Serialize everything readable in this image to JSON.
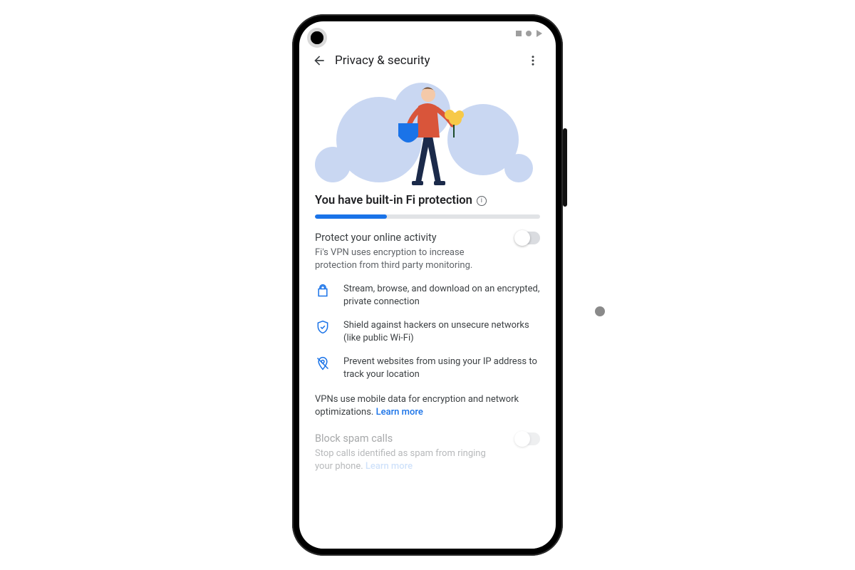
{
  "header": {
    "title": "Privacy & security"
  },
  "headline": "You have built-in Fi protection",
  "progress": {
    "percent": 32
  },
  "vpn": {
    "title": "Protect your online activity",
    "desc": "Fi's VPN uses encryption to increase protection from third party monitoring.",
    "toggle_on": false
  },
  "features": [
    {
      "icon": "lock-icon",
      "text": "Stream, browse, and download on an encrypted, private connection"
    },
    {
      "icon": "shield-check-icon",
      "text": "Shield against hackers on unsecure networks (like public Wi-Fi)"
    },
    {
      "icon": "location-off-icon",
      "text": "Prevent websites from using your IP address to track your location"
    }
  ],
  "footnote": {
    "text": "VPNs use mobile data for encryption and network optimizations. ",
    "link": "Learn more"
  },
  "spam": {
    "title": "Block spam calls",
    "desc": "Stop calls identified as spam from ringing your phone. ",
    "link": "Learn more",
    "toggle_on": false
  },
  "colors": {
    "accent": "#1a73e8"
  }
}
